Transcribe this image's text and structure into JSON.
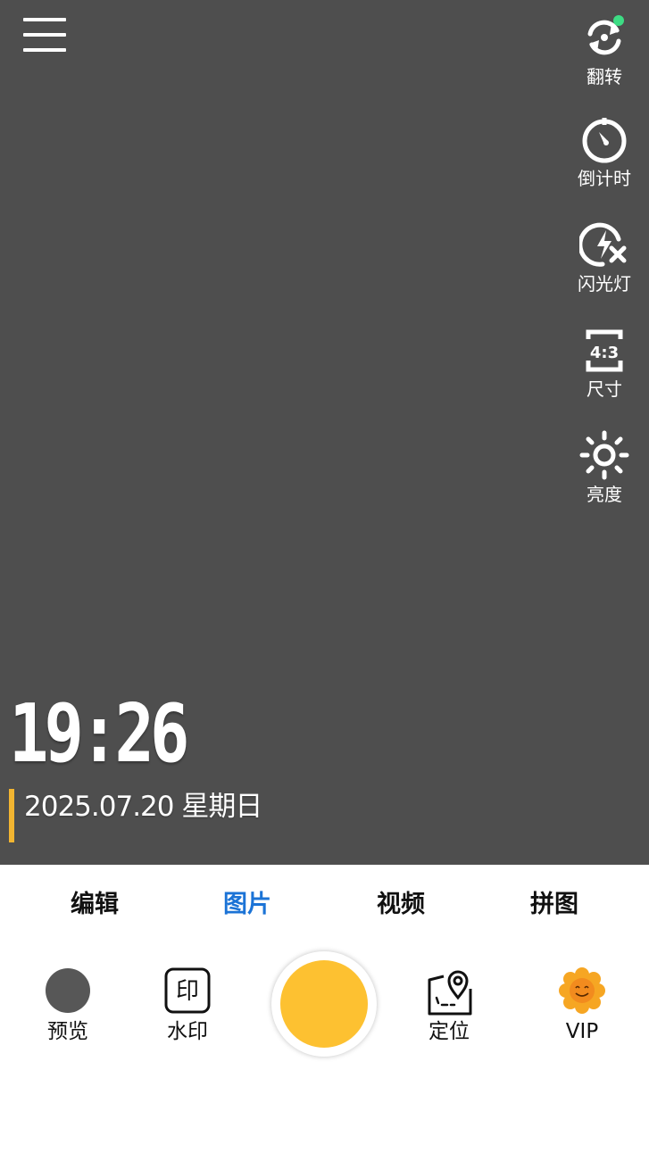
{
  "top_tools": [
    {
      "label": "翻转",
      "icon": "flip-camera-icon"
    },
    {
      "label": "倒计时",
      "icon": "timer-icon"
    },
    {
      "label": "闪光灯",
      "icon": "flash-off-icon"
    },
    {
      "label": "尺寸",
      "icon": "aspect-ratio-icon",
      "ratio_text": "4:3"
    },
    {
      "label": "亮度",
      "icon": "brightness-icon"
    }
  ],
  "watermark": {
    "time": "19:26",
    "date": "2025.07.20 星期日"
  },
  "modes": [
    {
      "label": "编辑",
      "active": false
    },
    {
      "label": "图片",
      "active": true
    },
    {
      "label": "视频",
      "active": false
    },
    {
      "label": "拼图",
      "active": false
    }
  ],
  "bottom_tools": {
    "preview": {
      "label": "预览",
      "icon": "preview-thumbnail-icon"
    },
    "watermark": {
      "label": "水印",
      "icon": "stamp-icon",
      "icon_char": "印"
    },
    "location": {
      "label": "定位",
      "icon": "map-pin-icon"
    },
    "vip": {
      "label": "VIP",
      "icon": "sunflower-icon"
    }
  },
  "colors": {
    "viewfinder_bg": "#4e4e4e",
    "active_tab": "#1b73d6",
    "shutter": "#fdc131",
    "date_accent": "#f2b531",
    "notification_dot": "#3ddc84"
  }
}
